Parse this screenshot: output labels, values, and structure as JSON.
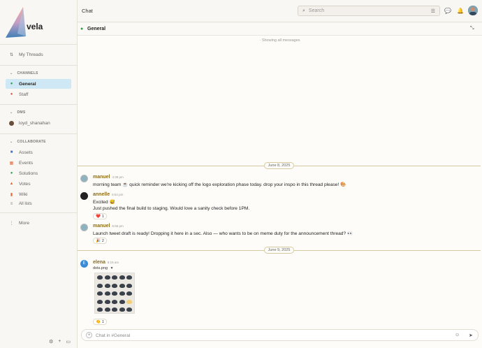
{
  "app": {
    "name": "vela",
    "brand_colors": {
      "logo_top": "#f2a8a0",
      "logo_bottom": "#3f7fb6",
      "accent": "#cfe8f6",
      "author": "#8a6d1f"
    }
  },
  "sidebar": {
    "my_threads": "My Threads",
    "channels_label": "CHANNELS",
    "channels": [
      {
        "label": "General",
        "icon": "chat-bubble-icon",
        "active": true
      },
      {
        "label": "Staff",
        "icon": "staff-icon",
        "active": false
      }
    ],
    "dms_label": "DMS",
    "dms": [
      {
        "label": "loyd_shanahan",
        "icon": "user-avatar"
      }
    ],
    "collaborate_label": "COLLABORATE",
    "collaborate": [
      {
        "label": "Assets",
        "icon": "grid-icon"
      },
      {
        "label": "Events",
        "icon": "calendar-icon"
      },
      {
        "label": "Solutions",
        "icon": "check-circle-icon"
      },
      {
        "label": "Votes",
        "icon": "thumbs-up-icon"
      },
      {
        "label": "Wiki",
        "icon": "book-icon"
      },
      {
        "label": "All lists",
        "icon": "list-icon"
      }
    ],
    "more": "More"
  },
  "topbar": {
    "title": "Chat",
    "search_placeholder": "Search"
  },
  "channel": {
    "name": "General",
    "showing": "· Showing all messages"
  },
  "dates": [
    "June 8, 2025",
    "June 9, 2025"
  ],
  "messages": [
    {
      "author": "manuel",
      "time": "4:39 pm",
      "lines": [
        "morning team ☕ quick reminder we're kicking off the logo exploration phase today. drop your inspo in this thread please! 🎨"
      ]
    },
    {
      "author": "annelle",
      "time": "6:54 pm",
      "lines": [
        "Excited 😅",
        "Just pushed the final build to staging. Would love a sanity check before 1PM."
      ],
      "reaction": {
        "emoji": "❤️",
        "count": "1"
      }
    },
    {
      "author": "manuel",
      "time": "6:56 pm",
      "lines": [
        "Launch tweet draft is ready! Dropping it here in a sec. Also — who wants to be on meme duty for the announcement thread? 👀"
      ],
      "reaction": {
        "emoji": "🎉",
        "count": "2"
      }
    },
    {
      "author": "elena",
      "avatar_letter": "E",
      "time": "8:15 am",
      "attachment": "dots.png",
      "reaction": {
        "emoji": "👏",
        "count": "1"
      }
    }
  ],
  "composer": {
    "placeholder": "Chat in #General"
  }
}
